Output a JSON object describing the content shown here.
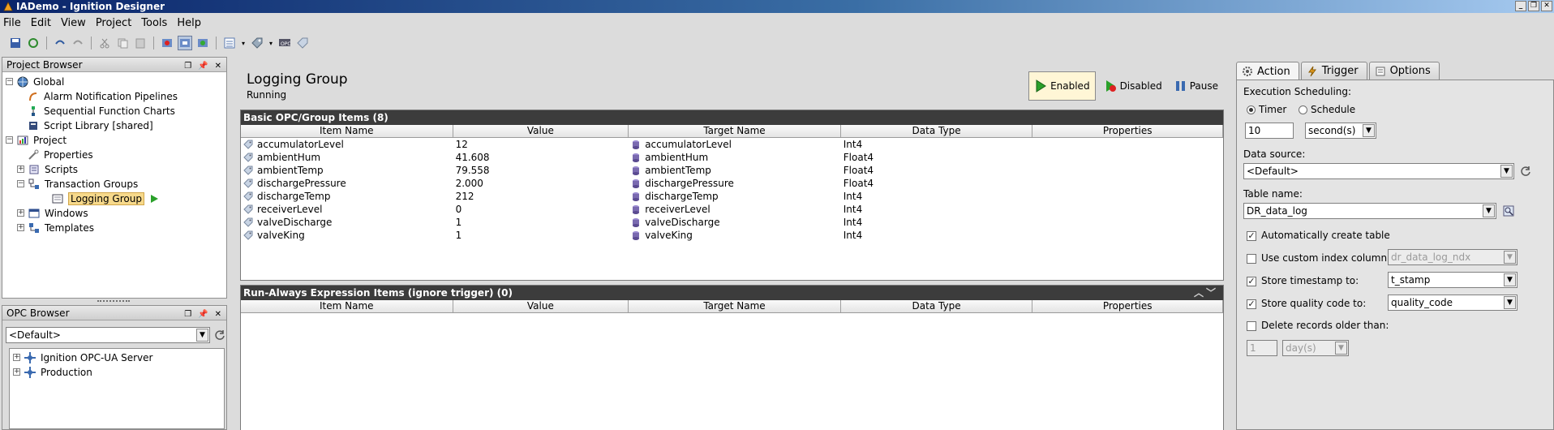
{
  "window": {
    "title": "IADemo - Ignition Designer"
  },
  "menu": [
    "File",
    "Edit",
    "View",
    "Project",
    "Tools",
    "Help"
  ],
  "project_browser": {
    "title": "Project Browser",
    "tree": [
      {
        "label": "Global",
        "icon": "globe-icon",
        "level": 0,
        "expander": "-"
      },
      {
        "label": "Alarm Notification Pipelines",
        "icon": "pipeline-icon",
        "level": 1
      },
      {
        "label": "Sequential Function Charts",
        "icon": "sfc-icon",
        "level": 1
      },
      {
        "label": "Script Library [shared]",
        "icon": "script-library-icon",
        "level": 1
      },
      {
        "label": "Project",
        "icon": "project-icon",
        "level": 0,
        "expander": "-"
      },
      {
        "label": "Properties",
        "icon": "properties-icon",
        "level": 1
      },
      {
        "label": "Scripts",
        "icon": "scripts-icon",
        "level": 1,
        "expander": "+"
      },
      {
        "label": "Transaction Groups",
        "icon": "transaction-groups-icon",
        "level": 1,
        "expander": "-"
      },
      {
        "label": "Logging Group",
        "icon": "logging-group-icon",
        "level": 2,
        "selected": true
      },
      {
        "label": "Windows",
        "icon": "windows-icon",
        "level": 1,
        "expander": "+"
      },
      {
        "label": "Templates",
        "icon": "templates-icon",
        "level": 1,
        "expander": "+"
      }
    ]
  },
  "opc_browser": {
    "title": "OPC Browser",
    "server_select": "<Default>",
    "tree": [
      {
        "label": "Ignition OPC-UA Server"
      },
      {
        "label": "Production"
      }
    ]
  },
  "group": {
    "title": "Logging Group",
    "status": "Running",
    "buttons": {
      "enabled": "Enabled",
      "disabled": "Disabled",
      "pause": "Pause"
    }
  },
  "basic_items": {
    "title": "Basic OPC/Group Items (8)",
    "columns": [
      "Item Name",
      "Value",
      "Target Name",
      "Data Type",
      "Properties"
    ],
    "rows": [
      {
        "name": "accumulatorLevel",
        "value": "12",
        "target": "accumulatorLevel",
        "type": "Int4"
      },
      {
        "name": "ambientHum",
        "value": "41.608",
        "target": "ambientHum",
        "type": "Float4"
      },
      {
        "name": "ambientTemp",
        "value": "79.558",
        "target": "ambientTemp",
        "type": "Float4"
      },
      {
        "name": "dischargePressure",
        "value": "2.000",
        "target": "dischargePressure",
        "type": "Float4"
      },
      {
        "name": "dischargeTemp",
        "value": "212",
        "target": "dischargeTemp",
        "type": "Int4"
      },
      {
        "name": "receiverLevel",
        "value": "0",
        "target": "receiverLevel",
        "type": "Int4"
      },
      {
        "name": "valveDischarge",
        "value": "1",
        "target": "valveDischarge",
        "type": "Int4"
      },
      {
        "name": "valveKing",
        "value": "1",
        "target": "valveKing",
        "type": "Int4"
      }
    ]
  },
  "run_always": {
    "title": "Run-Always Expression Items (ignore trigger) (0)",
    "columns": [
      "Item Name",
      "Value",
      "Target Name",
      "Data Type",
      "Properties"
    ]
  },
  "right_panel": {
    "tabs": [
      "Action",
      "Trigger",
      "Options"
    ],
    "execution_scheduling": "Execution Scheduling:",
    "timer_label": "Timer",
    "schedule_label": "Schedule",
    "rate_value": "10",
    "rate_unit": "second(s)",
    "data_source_label": "Data source:",
    "data_source_value": "<Default>",
    "table_name_label": "Table name:",
    "table_name_value": "DR_data_log",
    "auto_create": "Automatically create table",
    "custom_index": "Use custom index column:",
    "custom_index_value": "dr_data_log_ndx",
    "store_timestamp": "Store timestamp to:",
    "timestamp_value": "t_stamp",
    "store_quality": "Store quality code to:",
    "quality_value": "quality_code",
    "delete_older": "Delete records older than:",
    "delete_value": "1",
    "delete_unit": "day(s)"
  }
}
